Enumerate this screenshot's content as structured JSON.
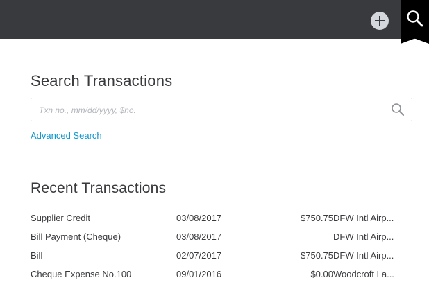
{
  "header": {
    "add_icon": "plus-circle-icon",
    "search_icon": "search-icon"
  },
  "search": {
    "title": "Search Transactions",
    "placeholder": "Txn no., mm/dd/yyyy, $no.",
    "value": "",
    "advanced_link": "Advanced Search"
  },
  "recent": {
    "title": "Recent Transactions",
    "rows": [
      {
        "type": "Supplier Credit",
        "date": "03/08/2017",
        "amount": "$750.75",
        "payee": "DFW Intl Airp..."
      },
      {
        "type": "Bill Payment (Cheque)",
        "date": "03/08/2017",
        "amount": "",
        "payee": "DFW Intl Airp..."
      },
      {
        "type": "Bill",
        "date": "02/07/2017",
        "amount": "$750.75",
        "payee": "DFW Intl Airp..."
      },
      {
        "type": "Cheque Expense No.100",
        "date": "09/01/2016",
        "amount": "$0.00",
        "payee": "Woodcroft La..."
      }
    ]
  },
  "colors": {
    "topbar": "#393a3d",
    "active_tab": "#000000",
    "link": "#0d97d1",
    "text": "#393a3d"
  }
}
